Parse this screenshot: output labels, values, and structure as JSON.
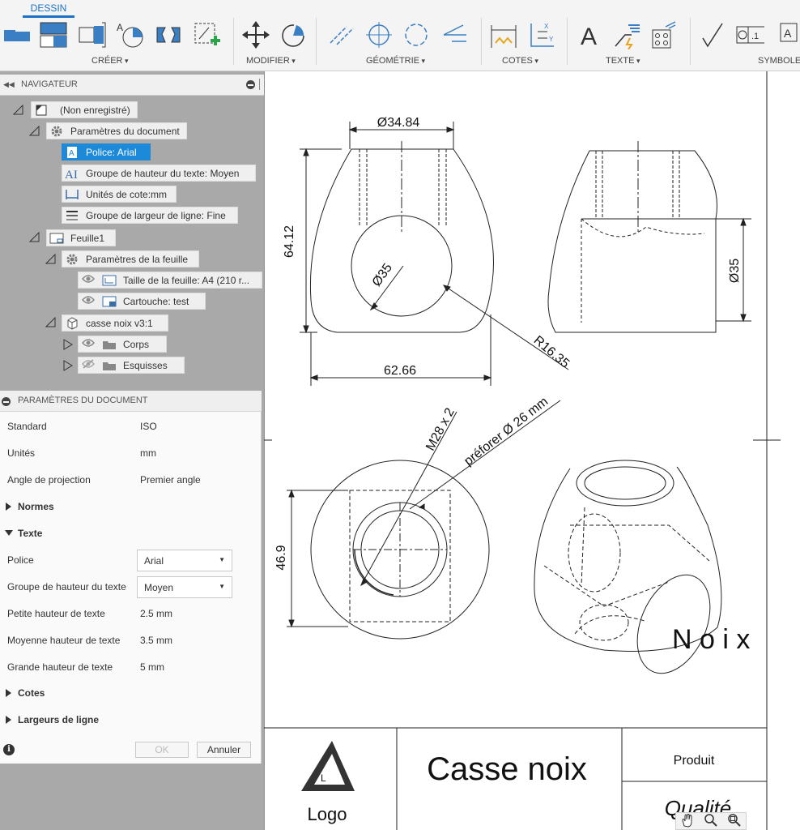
{
  "ribbon": {
    "active_tab": "DESSIN",
    "groups": [
      "CRÉER",
      "MODIFIER",
      "GÉOMÉTRIE",
      "COTES",
      "TEXTE",
      "SYMBOLE"
    ]
  },
  "navigator": {
    "title": "NAVIGATEUR",
    "root": "(Non enregistré)",
    "doc_params": "Paramètres du document",
    "font": "Police: Arial",
    "text_height_group": "Groupe de hauteur du texte: Moyen",
    "dim_units": "Unités de cote:mm",
    "line_width_group": "Groupe de largeur de ligne: Fine",
    "sheet": "Feuille1",
    "sheet_params": "Paramètres de la feuille",
    "sheet_size": "Taille de la feuille: A4 (210 r...",
    "title_block": "Cartouche: test",
    "component": "casse noix v3:1",
    "bodies": "Corps",
    "sketches": "Esquisses"
  },
  "params": {
    "title": "PARAMÈTRES DU DOCUMENT",
    "standard_label": "Standard",
    "standard": "ISO",
    "units_label": "Unités",
    "units": "mm",
    "projection_label": "Angle de projection",
    "projection": "Premier angle",
    "norms": "Normes",
    "text_section": "Texte",
    "font_label": "Police",
    "font": "Arial",
    "height_group_label": "Groupe de hauteur du texte",
    "height_group": "Moyen",
    "small_label": "Petite hauteur de texte",
    "small": "2.5 mm",
    "medium_label": "Moyenne hauteur de texte",
    "medium": "3.5 mm",
    "large_label": "Grande hauteur de texte",
    "large": "5 mm",
    "dims_section": "Cotes",
    "line_widths_section": "Largeurs de ligne",
    "ok": "OK",
    "cancel": "Annuler"
  },
  "drawing": {
    "dim_top_width": "Ø34.84",
    "dim_height": "64.12",
    "dim_hole": "Ø35",
    "dim_radius": "R16.35",
    "dim_bottom_width": "62.66",
    "dim_side_hole": "Ø35",
    "thread_note": "M28 x 2",
    "predrill_note": "préforer Ø 26 mm",
    "dim_top_view_height": "46.9",
    "iso_label": "N o i x",
    "title": "Casse noix",
    "logo": "Logo",
    "logo_letter": "L",
    "product_label": "Produit",
    "quality_label": "Qualité"
  }
}
